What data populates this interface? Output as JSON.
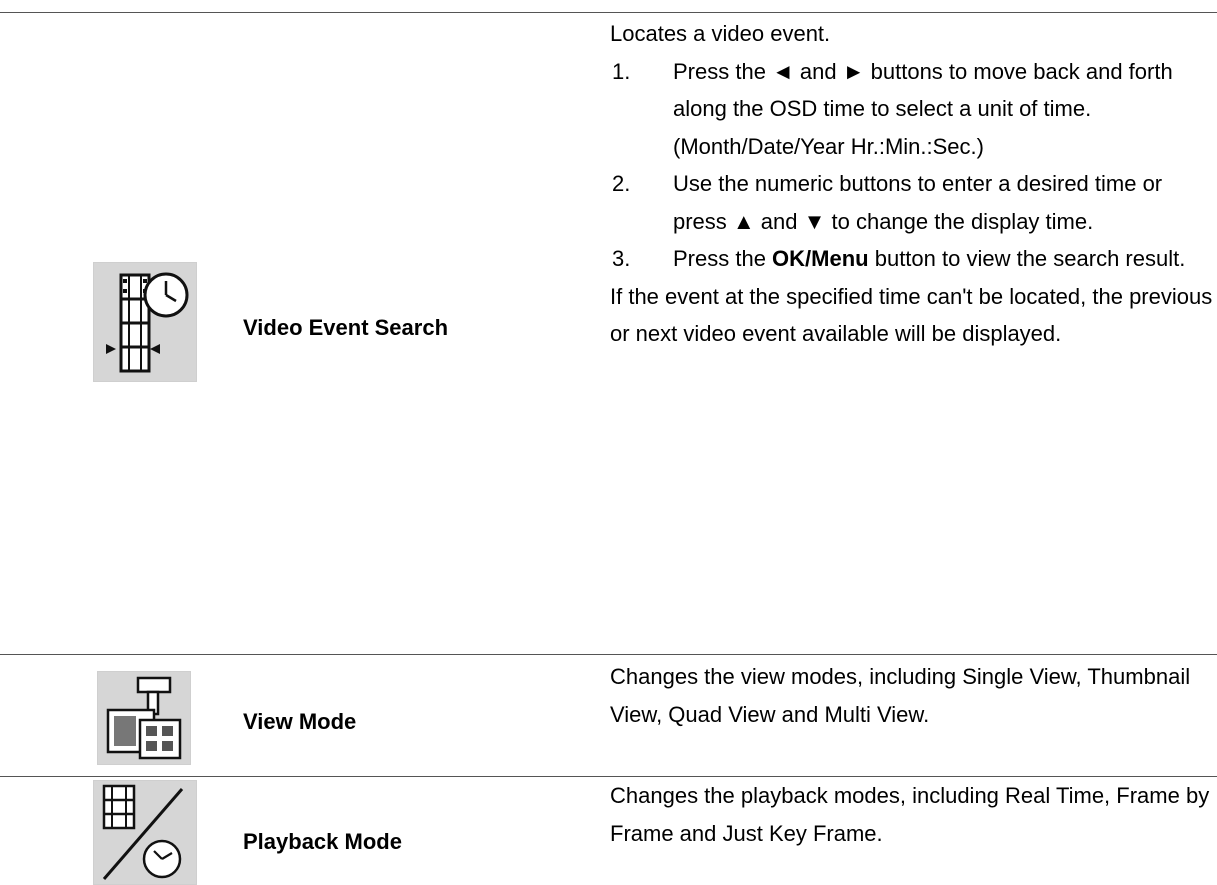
{
  "rows": [
    {
      "name": "Video Event Search",
      "icon": "film-clock-search-icon",
      "intro": "Locates a video event.",
      "steps": [
        {
          "num": "1.",
          "text": "Press the ◄ and ► buttons to move back and forth along the OSD time to select a unit of time. (Month/Date/Year Hr.:Min.:Sec.)"
        },
        {
          "num": "2.",
          "text": "Use the numeric buttons to enter a desired time or press ▲ and ▼ to change the display time."
        },
        {
          "num": "3.",
          "pre": "Press the ",
          "bold": "OK/Menu",
          "post": " button to view the search result."
        }
      ],
      "note": "If the event at the specified time can't be located, the previous or next video event available will be displayed."
    },
    {
      "name": "View Mode",
      "icon": "view-mode-icon",
      "text": "Changes the view modes, including Single View, Thumbnail View, Quad View and Multi View."
    },
    {
      "name": "Playback Mode",
      "icon": "playback-mode-icon",
      "text": "Changes the playback modes, including Real Time, Frame by Frame and Just Key Frame."
    }
  ]
}
